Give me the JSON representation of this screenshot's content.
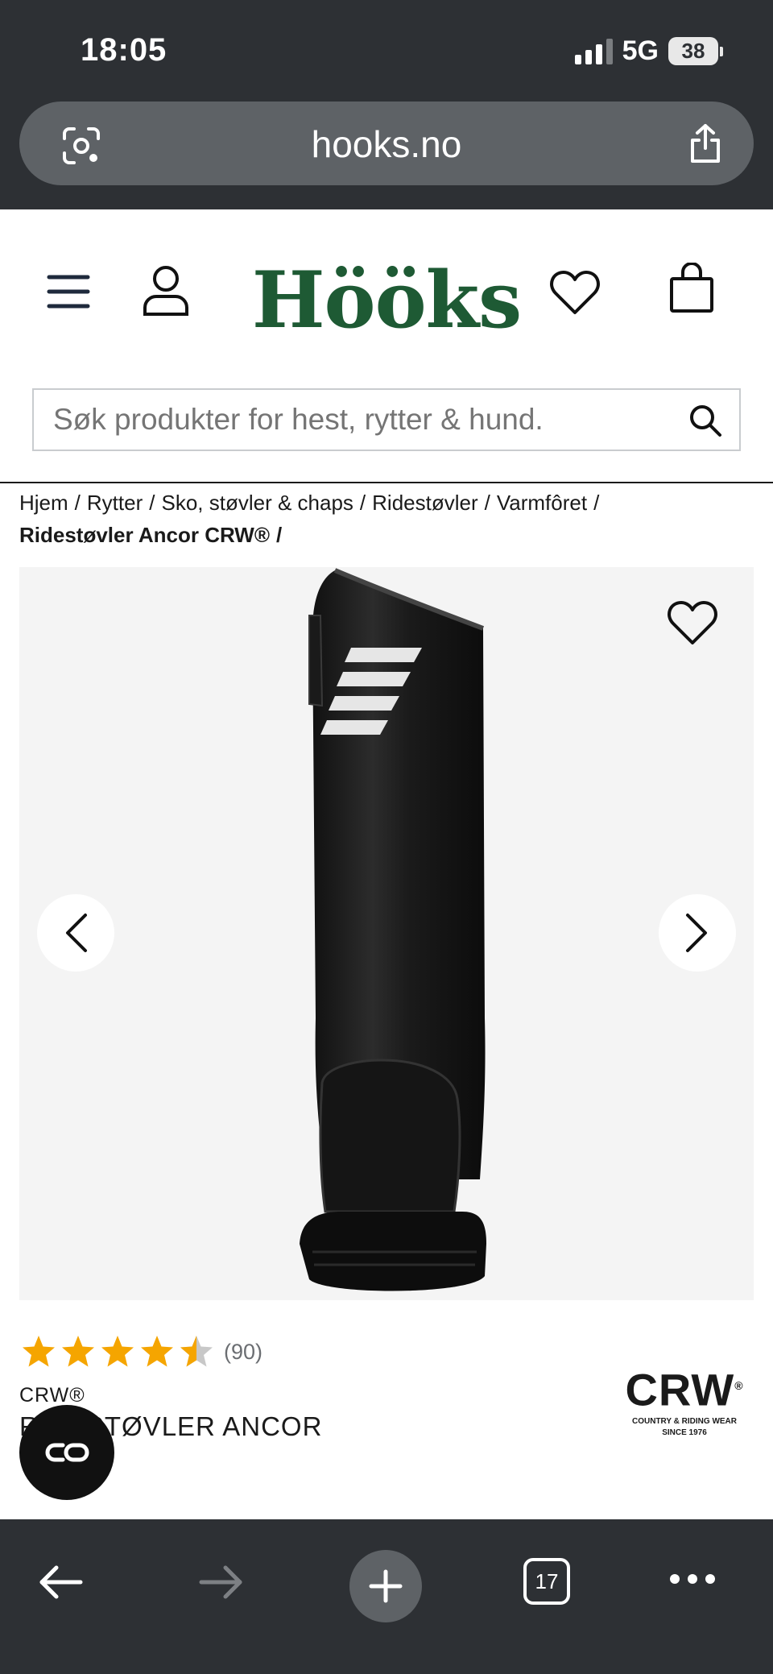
{
  "status_bar": {
    "time": "18:05",
    "network": "5G",
    "battery": "38"
  },
  "browser": {
    "url": "hooks.no",
    "tab_count": "17"
  },
  "site": {
    "logo": "Hööks",
    "search_placeholder": "Søk produkter for hest, rytter & hund."
  },
  "breadcrumb": {
    "items": [
      "Hjem",
      "Rytter",
      "Sko, støvler & chaps",
      "Ridestøvler",
      "Varmfôret"
    ],
    "current": "Ridestøvler Ancor CRW®",
    "separator": "/"
  },
  "product": {
    "rating": 4.5,
    "rating_count": "(90)",
    "brand": "CRW®",
    "name": "RIDESTØVLER ANCOR",
    "brand_logo_text": "CRW",
    "brand_logo_mark": "®",
    "brand_logo_tagline_1": "COUNTRY & RIDING WEAR",
    "brand_logo_tagline_2": "SINCE 1976"
  },
  "colors": {
    "browser_chrome": "#2d3034",
    "url_pill": "#5e6266",
    "logo_green": "#1e5a34",
    "star": "#f5a500",
    "star_empty": "#c8c8c8",
    "gallery_bg": "#f4f4f4"
  },
  "icons": {
    "lens": "camera-lens-icon",
    "share": "share-icon",
    "menu": "hamburger-menu-icon",
    "account": "user-icon",
    "wishlist": "heart-icon",
    "cart": "shopping-bag-icon",
    "search": "search-icon",
    "prev": "chevron-left-icon",
    "next": "chevron-right-icon",
    "chat": "chat-bubble-icon",
    "back": "arrow-left-icon",
    "forward": "arrow-right-icon",
    "new_tab": "plus-icon",
    "more": "ellipsis-icon"
  }
}
